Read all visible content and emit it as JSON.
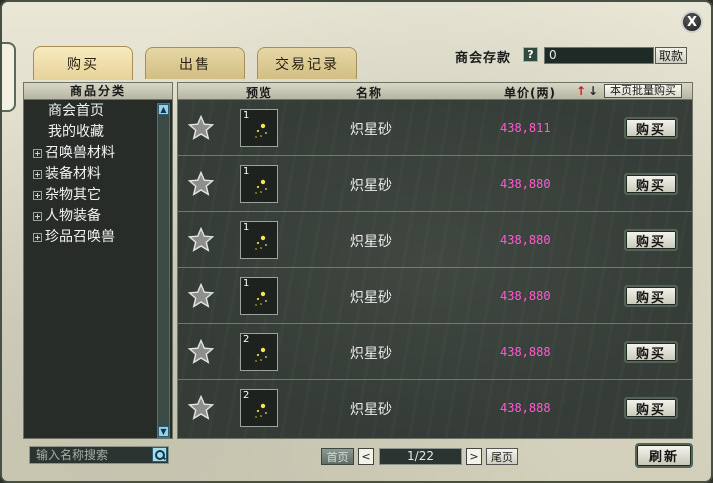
{
  "close_label": "X",
  "tabs": [
    {
      "label": "购买",
      "active": true
    },
    {
      "label": "出售",
      "active": false
    },
    {
      "label": "交易记录",
      "active": false
    }
  ],
  "deposit": {
    "label": "商会存款",
    "help": "?",
    "value": "0",
    "withdraw_label": "取款"
  },
  "categories": {
    "header": "商品分类",
    "items": [
      {
        "label": "商会首页",
        "expandable": false
      },
      {
        "label": "我的收藏",
        "expandable": false
      },
      {
        "label": "召唤兽材料",
        "expandable": true
      },
      {
        "label": "装备材料",
        "expandable": true
      },
      {
        "label": "杂物其它",
        "expandable": true
      },
      {
        "label": "人物装备",
        "expandable": true
      },
      {
        "label": "珍品召唤兽",
        "expandable": true
      }
    ]
  },
  "table": {
    "col_preview": "预览",
    "col_name": "名称",
    "col_price": "单价(两)",
    "sort_up": "↑",
    "sort_down": "↓",
    "batch_buy": "本页批量购买",
    "buy_label": "购买",
    "rows": [
      {
        "qty": "1",
        "name": "炽星砂",
        "price": "438,811"
      },
      {
        "qty": "1",
        "name": "炽星砂",
        "price": "438,880"
      },
      {
        "qty": "1",
        "name": "炽星砂",
        "price": "438,880"
      },
      {
        "qty": "1",
        "name": "炽星砂",
        "price": "438,880"
      },
      {
        "qty": "2",
        "name": "炽星砂",
        "price": "438,888"
      },
      {
        "qty": "2",
        "name": "炽星砂",
        "price": "438,888"
      }
    ]
  },
  "search": {
    "placeholder": "输入名称搜索"
  },
  "pagination": {
    "first": "首页",
    "prev": "<",
    "info": "1/22",
    "next": ">",
    "last": "尾页"
  },
  "refresh_label": "刷新",
  "colors": {
    "price": "#ff5ad1",
    "sort_up": "#d21d1d",
    "panel": "#272c28"
  }
}
